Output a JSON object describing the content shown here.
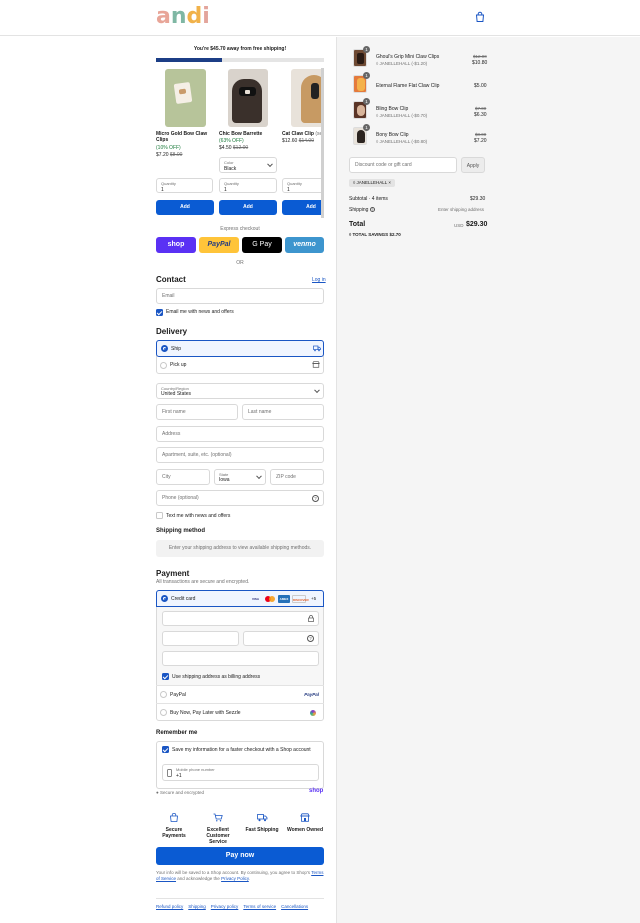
{
  "header": {
    "logo_letters": [
      "a",
      "n",
      "d",
      "i"
    ],
    "logo_colors": [
      "#e8a598",
      "#7fb7a4",
      "#f1b24a",
      "#e3a59c"
    ],
    "cart_icon": "shopping-bag-icon"
  },
  "shipping_banner": {
    "text": "You're $45.70 away from free shipping!",
    "progress_fraction": 0.39,
    "bar_color": "#1c3e86"
  },
  "upsell": {
    "products": [
      {
        "name": "Micro Gold Bow Claw Clips",
        "discount": "(10% OFF)",
        "price": "$7.20",
        "original": "$8.00",
        "qty_label": "Quantity",
        "qty": "1",
        "add_label": "Add"
      },
      {
        "name": "Chic Bow Barrette",
        "discount": "(63% OFF)",
        "price": "$4.50",
        "original": "$12.00",
        "color_label": "Color",
        "color_value": "Black",
        "qty_label": "Quantity",
        "qty": "1",
        "add_label": "Add"
      },
      {
        "name": "Cat Claw Clip",
        "name_suffix": "(sel",
        "price": "$12.60",
        "original": "$14.00",
        "qty_label": "Quantity",
        "qty": "1",
        "add_label": "Add"
      }
    ]
  },
  "express": {
    "label": "Express checkout",
    "buttons": [
      {
        "label": "shop",
        "bg": "#5a31f4",
        "fg": "#ffffff"
      },
      {
        "label": "PayPal",
        "bg": "#ffc439",
        "fg": "#253b80"
      },
      {
        "label": "G Pay",
        "bg": "#000000",
        "fg": "#ffffff"
      },
      {
        "label": "venmo",
        "bg": "#3d95ce",
        "fg": "#ffffff"
      }
    ],
    "or_label": "OR"
  },
  "contact": {
    "title": "Contact",
    "login_link": "Log in",
    "email_placeholder": "Email",
    "news_checkbox": "Email me with news and offers"
  },
  "delivery": {
    "title": "Delivery",
    "options": [
      {
        "label": "Ship",
        "icon": "truck-icon"
      },
      {
        "label": "Pick up",
        "icon": "store-icon"
      }
    ],
    "country_label": "Country/Region",
    "country_value": "United States",
    "first_name": "First name",
    "last_name": "Last name",
    "address": "Address",
    "apartment": "Apartment, suite, etc. (optional)",
    "city": "City",
    "state_label": "State",
    "state_value": "Iowa",
    "zip": "ZIP code",
    "phone": "Phone (optional)",
    "text_me": "Text me with news and offers"
  },
  "shipping_method": {
    "title": "Shipping method",
    "message": "Enter your shipping address to view available shipping methods."
  },
  "payment": {
    "title": "Payment",
    "subtitle": "All transactions are secure and encrypted.",
    "credit_card_label": "Credit card",
    "card_brands": [
      {
        "label": "VISA",
        "bg": "#ffffff",
        "fg": "#1a1f71"
      },
      {
        "label": "MC",
        "bg": "#ffffff",
        "fg": "#eb001b"
      },
      {
        "label": "AMEX",
        "bg": "#2671b9",
        "fg": "#ffffff"
      },
      {
        "label": "DISCOVER",
        "bg": "#ffffff",
        "fg": "#e55c20"
      }
    ],
    "more_cards": "+5",
    "billing_checkbox": "Use shipping address as billing address",
    "paypal_label": "PayPal",
    "paypal_logo": "PayPal",
    "sezzle_label": "Buy Now, Pay Later with Sezzle"
  },
  "remember": {
    "title": "Remember me",
    "save_checkbox": "Save my information for a faster checkout with a Shop account",
    "mobile_label": "Mobile phone number",
    "mobile_value": "+1",
    "secure_text": "Secure and encrypted",
    "shop_logo": "shop"
  },
  "features": [
    {
      "label": "Secure Payments",
      "icon": "lock-bag-icon"
    },
    {
      "label": "Excellent Customer Service",
      "icon": "shopping-cart-icon"
    },
    {
      "label": "Fast Shipping",
      "icon": "truck-icon"
    },
    {
      "label": "Women Owned",
      "icon": "storefront-icon"
    }
  ],
  "pay_button": "Pay now",
  "legal": {
    "line1": "Your info will be saved to a Shop account. By continuing, you agree to Shop's",
    "terms": "Terms of Service",
    "and": "and acknowledge the",
    "privacy": "Privacy Policy",
    "end": "."
  },
  "footer_links": [
    "Refund policy",
    "Shipping",
    "Privacy policy",
    "Terms of service",
    "Cancellations"
  ],
  "order": {
    "items": [
      {
        "qty": "1",
        "name": "Ghoul's Grip Mini Claw Clips",
        "discount": "JANELLEHALL (-$1.20)",
        "original": "$12.00",
        "price": "$10.80"
      },
      {
        "qty": "1",
        "name": "Eternal Flame Flat Claw Clip",
        "price": "$5.00"
      },
      {
        "qty": "1",
        "name": "Bling Bow Clip",
        "discount": "JANELLEHALL (-$0.70)",
        "original": "$7.00",
        "price": "$6.30"
      },
      {
        "qty": "1",
        "name": "Bony Bow Clip",
        "discount": "JANELLEHALL (-$0.80)",
        "original": "$8.00",
        "price": "$7.20"
      }
    ],
    "discount_placeholder": "Discount code or gift card",
    "apply_label": "Apply",
    "applied_code": "JANELLEHALL",
    "subtotal_label": "Subtotal · 4 items",
    "subtotal_value": "$29.30",
    "shipping_label": "Shipping",
    "shipping_value": "Enter shipping address",
    "total_label": "Total",
    "currency": "USD",
    "total_value": "$29.30",
    "savings_label": "TOTAL SAVINGS",
    "savings_value": "$2.70"
  }
}
